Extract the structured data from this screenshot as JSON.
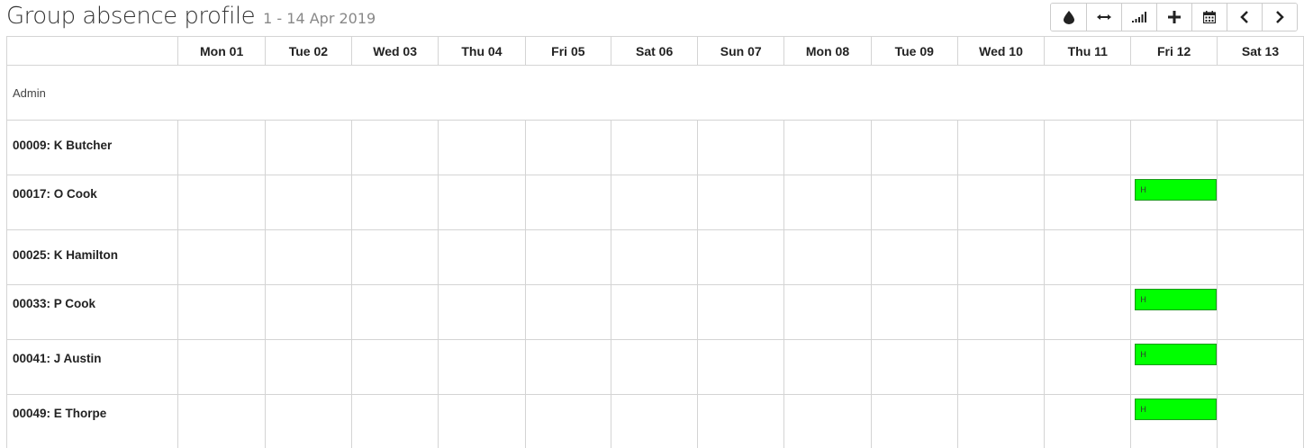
{
  "header": {
    "title": "Group absence profile",
    "date_range": "1 - 14 Apr 2019"
  },
  "toolbar": {
    "buttons": [
      {
        "icon": "drop-icon",
        "glyph": "💧"
      },
      {
        "icon": "horizontal-arrows-icon",
        "glyph": "⟷"
      },
      {
        "icon": "signal-bars-icon",
        "glyph": "▁▂▃▅"
      },
      {
        "icon": "plus-icon",
        "glyph": "+"
      },
      {
        "icon": "calendar-icon",
        "glyph": "📅"
      },
      {
        "icon": "chevron-left-icon",
        "glyph": "‹"
      },
      {
        "icon": "chevron-right-icon",
        "glyph": "›"
      }
    ]
  },
  "days": [
    "Mon 01",
    "Tue 02",
    "Wed 03",
    "Thu 04",
    "Fri 05",
    "Sat 06",
    "Sun 07",
    "Mon 08",
    "Tue 09",
    "Wed 10",
    "Thu 11",
    "Fri 12",
    "Sat 13"
  ],
  "group": {
    "label": "Admin"
  },
  "employees": [
    {
      "name": "00009: K Butcher",
      "absences": []
    },
    {
      "name": "00017: O Cook",
      "absences": [
        {
          "day": "Fri 12",
          "code": "H"
        }
      ]
    },
    {
      "name": "00025: K Hamilton",
      "absences": []
    },
    {
      "name": "00033: P Cook",
      "absences": [
        {
          "day": "Fri 12",
          "code": "H"
        }
      ]
    },
    {
      "name": "00041: J Austin",
      "absences": [
        {
          "day": "Fri 12",
          "code": "H"
        }
      ]
    },
    {
      "name": "00049: E Thorpe",
      "absences": [
        {
          "day": "Fri 12",
          "code": "H"
        }
      ]
    }
  ],
  "colors": {
    "absence_holiday": "#00ff00"
  }
}
